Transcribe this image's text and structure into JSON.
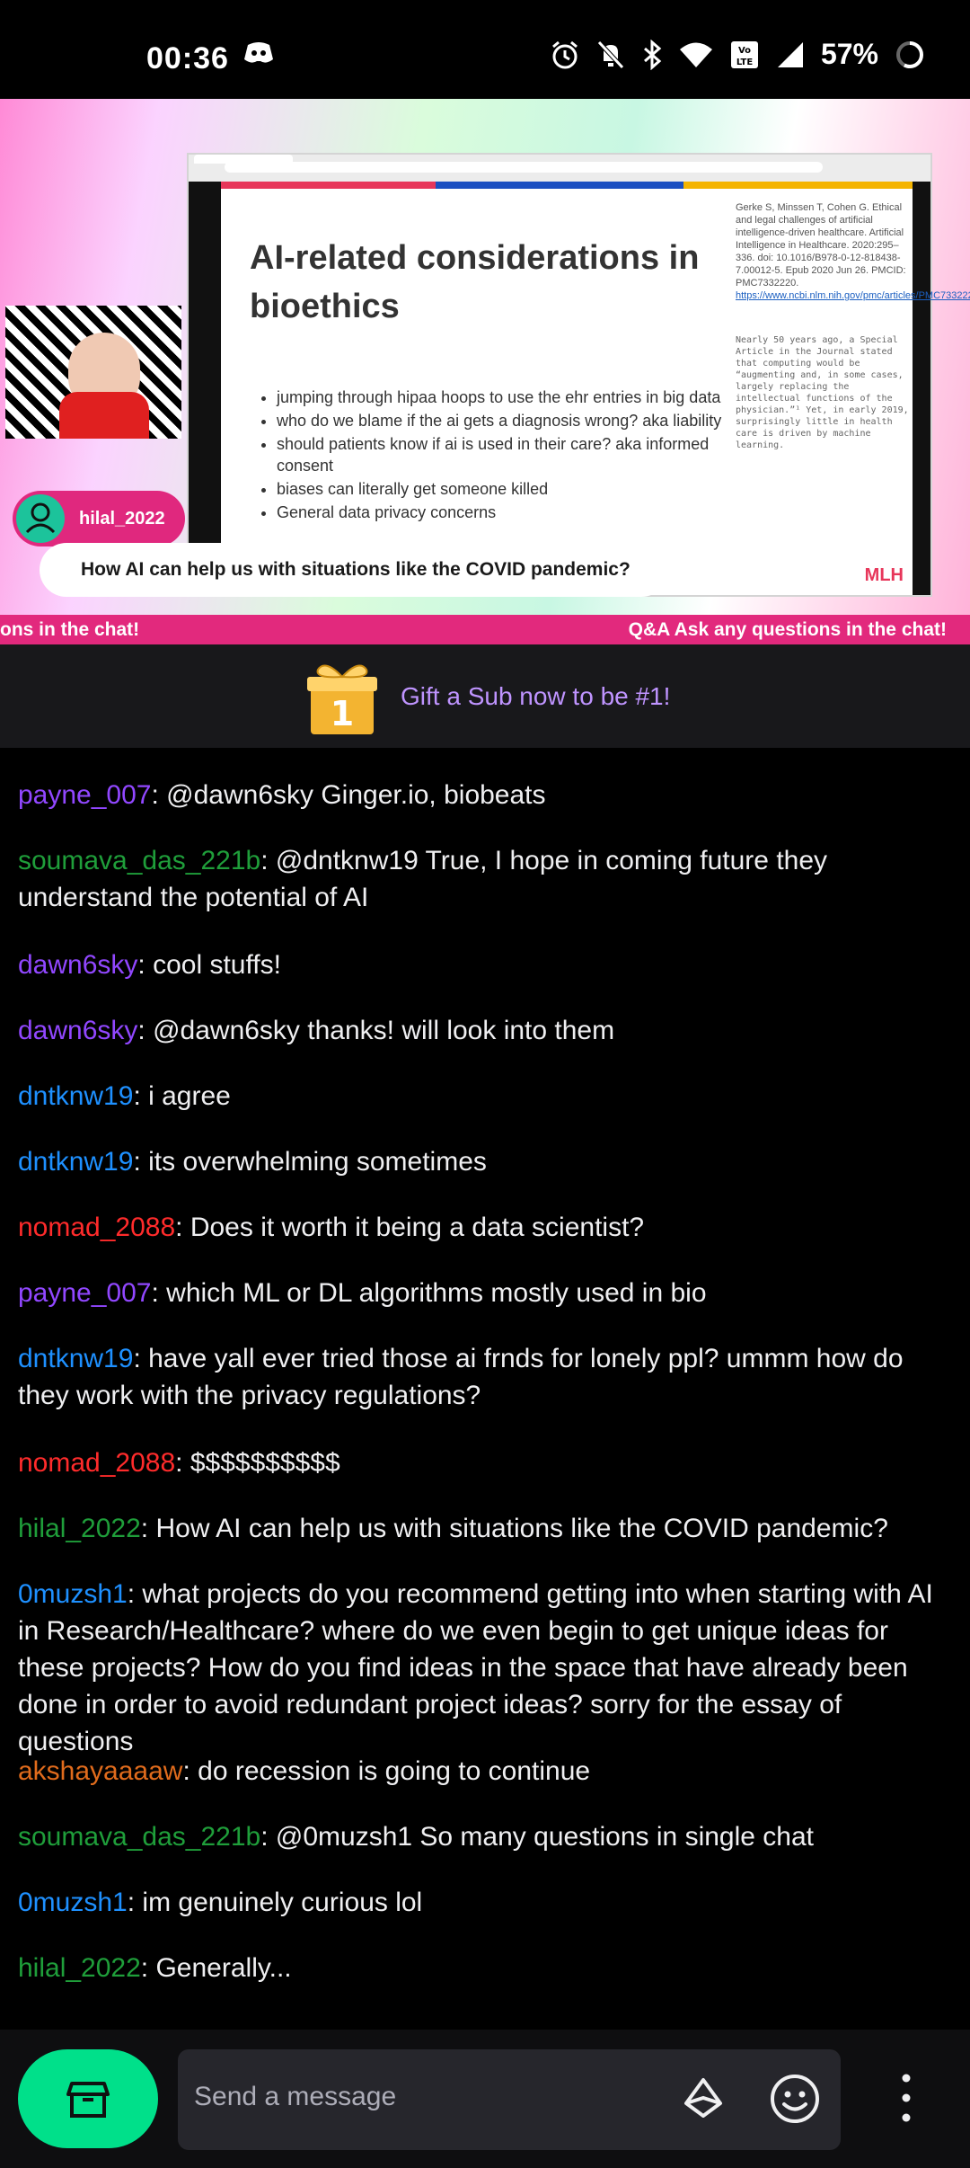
{
  "status_bar": {
    "time": "00:36",
    "battery": "57%",
    "icons": [
      "discord-icon",
      "alarm-icon",
      "mute-icon",
      "bluetooth-icon",
      "wifi-icon",
      "volte-icon",
      "signal-icon",
      "battery-icon"
    ]
  },
  "stream": {
    "slide_title": "AI-related considerations in bioethics",
    "bullets": [
      "jumping through hipaa hoops to use the ehr entries in big data",
      "who do we blame if the ai gets a diagnosis wrong? aka liability",
      "should patients know if ai is used in their care? aka informed consent",
      "biases can literally get someone killed",
      "General data privacy concerns"
    ],
    "reference": "Gerke S, Minssen T, Cohen G. Ethical and legal challenges of artificial intelligence-driven healthcare. Artificial Intelligence in Healthcare. 2020:295–336. doi: 10.1016/B978-0-12-818438-7.00012-5. Epub 2020 Jun 26. PMCID: PMC7332220.",
    "reference_link": "https://www.ncbi.nlm.nih.gov/pmc/articles/PMC7332220/",
    "quote": "Nearly 50 years ago, a Special Article in the Journal stated that computing would be “augmenting and, in some cases, largely replacing the intellectual functions of the physician.”¹ Yet, in early 2019, surprisingly little in health care is driven by machine learning.",
    "logo": "MLH",
    "user_pill": "hilal_2022",
    "question": "How AI can help us with situations like the COVID pandemic?",
    "ticker_left": "ons in the chat!",
    "ticker_right": "Q&A Ask any questions in the chat!"
  },
  "gift_banner": {
    "text": "Gift a Sub now to be #1!",
    "badge": "1"
  },
  "colors": {
    "purple": "#9147ff",
    "green": "#1f9e3a",
    "blue": "#1e90ff",
    "red": "#ff2b2b",
    "orange": "#e06b1c",
    "accent": "#00e08a"
  },
  "chat": [
    {
      "user": "payne_007",
      "color": "#9147ff",
      "text": ": @dawn6sky Ginger.io, biobeats"
    },
    {
      "user": "soumava_das_221b",
      "color": "#1f9e3a",
      "text": ": @dntknw19 True, I hope in coming future they understand the potential of AI"
    },
    {
      "user": "dawn6sky",
      "color": "#9147ff",
      "text": ": cool stuffs!"
    },
    {
      "user": "dawn6sky",
      "color": "#9147ff",
      "text": ": @dawn6sky thanks! will look into them"
    },
    {
      "user": "dntknw19",
      "color": "#1e90ff",
      "text": ": i agree"
    },
    {
      "user": "dntknw19",
      "color": "#1e90ff",
      "text": ": its overwhelming sometimes"
    },
    {
      "user": "nomad_2088",
      "color": "#ff2b2b",
      "text": ": Does it worth it being a data scientist?"
    },
    {
      "user": "payne_007",
      "color": "#9147ff",
      "text": ": which ML or DL algorithms mostly used in bio"
    },
    {
      "user": "dntknw19",
      "color": "#1e90ff",
      "text": ": have yall ever tried those ai frnds for lonely ppl? ummm how do they work with the privacy regulations?"
    },
    {
      "user": "nomad_2088",
      "color": "#ff2b2b",
      "text": ": $$$$$$$$$$"
    },
    {
      "user": "hilal_2022",
      "color": "#1f9e3a",
      "text": ": How AI can help us with situations like the COVID pandemic?"
    },
    {
      "user": "0muzsh1",
      "color": "#1e90ff",
      "text": ": what projects do you recommend getting into when starting with AI in Research/Healthcare? where do we even begin to get unique ideas for these projects? How do you find ideas in the space that have already been done in order to avoid redundant project ideas?  sorry for the essay of questions"
    },
    {
      "user": "akshayaaaaw",
      "color": "#e06b1c",
      "text": ": do recession is going to continue"
    },
    {
      "user": "soumava_das_221b",
      "color": "#1f9e3a",
      "text": ": @0muzsh1 So many questions in single chat"
    },
    {
      "user": "0muzsh1",
      "color": "#1e90ff",
      "text": ": im genuinely curious lol"
    },
    {
      "user": "hilal_2022",
      "color": "#1f9e3a",
      "text": ": Generally..."
    }
  ],
  "input": {
    "placeholder": "Send a message"
  }
}
